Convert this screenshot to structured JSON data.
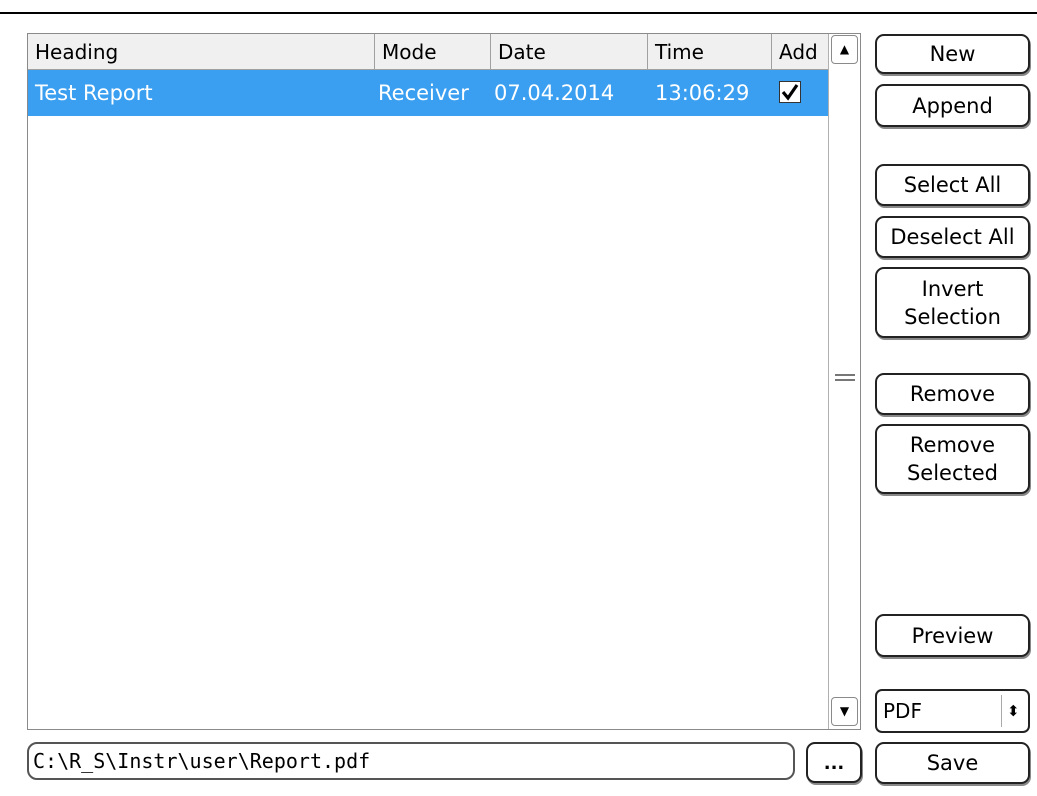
{
  "table": {
    "columns": [
      "Heading",
      "Mode",
      "Date",
      "Time",
      "Add"
    ],
    "rows": [
      {
        "heading": "Test Report",
        "mode": "Receiver",
        "date": "07.04.2014",
        "time": "13:06:29",
        "add_checked": true
      }
    ]
  },
  "buttons": {
    "new": "New",
    "append": "Append",
    "select_all": "Select All",
    "deselect_all": "Deselect All",
    "invert_selection": "Invert\nSelection",
    "remove": "Remove",
    "remove_selected": "Remove\nSelected",
    "preview": "Preview",
    "save": "Save",
    "browse": "..."
  },
  "format_select": {
    "value": "PDF"
  },
  "file_path": "C:\\R_S\\Instr\\user\\Report.pdf",
  "colors": {
    "row_selected": "#3a9ff0"
  },
  "icons": {
    "scroll_up": "up-arrow",
    "scroll_down": "down-arrow",
    "format_spinner": "up-down-arrows",
    "checkbox": "check-mark"
  }
}
